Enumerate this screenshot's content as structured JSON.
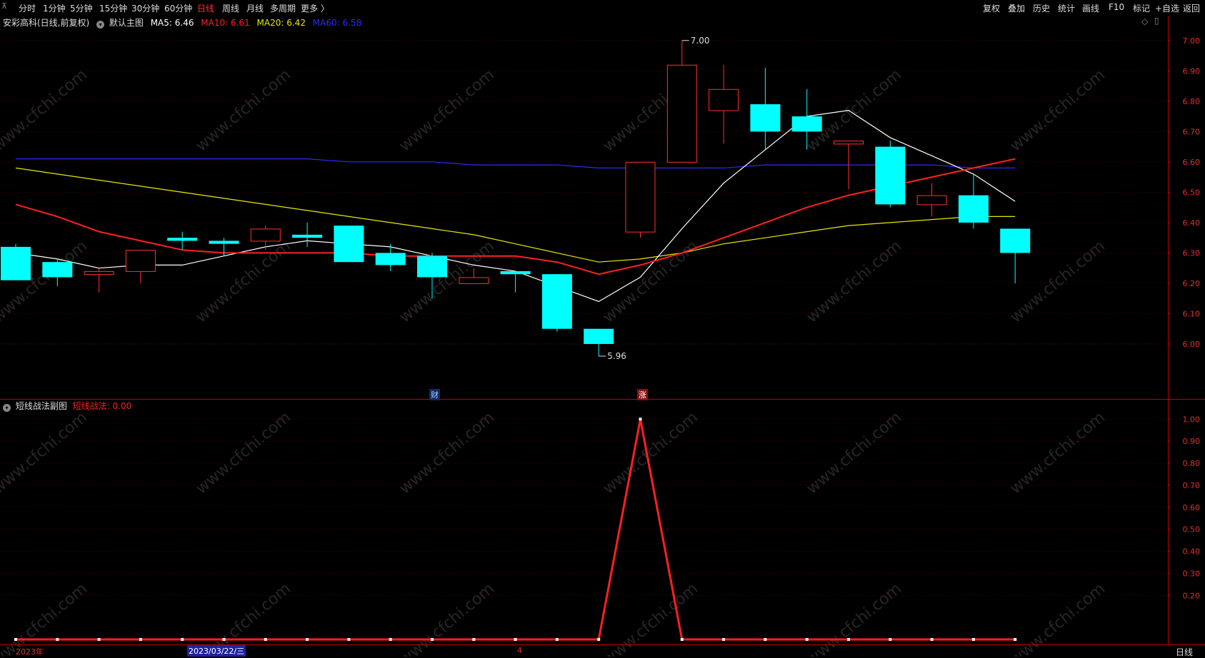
{
  "toolbar": {
    "left_items": [
      "分时",
      "1分钟",
      "5分钟",
      "15分钟",
      "30分钟",
      "60分钟",
      "日线",
      "周线",
      "月线",
      "多周期",
      "更多 〉"
    ],
    "active": "日线",
    "right_items": [
      "复权",
      "叠加",
      "历史",
      "统计",
      "画线",
      "F10",
      "标记",
      "+自选",
      "返回"
    ]
  },
  "main_info": {
    "stock": "安彩高科(日线,前复权)",
    "template": "默认主图",
    "ma": [
      {
        "label": "MA5: 6.46",
        "color": "#ffffff"
      },
      {
        "label": "MA10: 6.61",
        "color": "#ff2020"
      },
      {
        "label": "MA20: 6.42",
        "color": "#e8e800"
      },
      {
        "label": "MA60: 6.58",
        "color": "#2a2aff"
      }
    ]
  },
  "sub_info": {
    "title": "短线战法副图",
    "value_label": "短线战法: 0.00",
    "value_color": "#ff2020"
  },
  "footer": {
    "year": "2023年",
    "date": "2023/03/22/三",
    "month": "4",
    "period": "日线"
  },
  "markers": {
    "cai": "财",
    "zhang": "涨"
  },
  "watermark": "www.cfchi.com",
  "colors": {
    "up": "#ff3030",
    "down": "#00ffff",
    "grid": "#5a0000",
    "axis": "#c00000"
  },
  "chart_data": [
    {
      "type": "candlestick",
      "title": "安彩高科(日线,前复权)",
      "ylim": [
        5.92,
        7.03
      ],
      "y_ticks": [
        7.0,
        6.9,
        6.8,
        6.7,
        6.6,
        6.5,
        6.4,
        6.3,
        6.2,
        6.1,
        6.0
      ],
      "tick_labels": [
        "7.00",
        "6.90",
        "6.80",
        "6.70",
        "6.60",
        "6.50",
        "6.40",
        "6.30",
        "6.20",
        "6.10",
        "6.00"
      ],
      "candles": [
        {
          "o": 6.32,
          "c": 6.21,
          "h": 6.33,
          "l": 6.21
        },
        {
          "o": 6.27,
          "c": 6.22,
          "h": 6.28,
          "l": 6.19
        },
        {
          "o": 6.23,
          "c": 6.24,
          "h": 6.25,
          "l": 6.17
        },
        {
          "o": 6.24,
          "c": 6.31,
          "h": 6.31,
          "l": 6.2
        },
        {
          "o": 6.35,
          "c": 6.34,
          "h": 6.37,
          "l": 6.31
        },
        {
          "o": 6.34,
          "c": 6.33,
          "h": 6.35,
          "l": 6.29
        },
        {
          "o": 6.34,
          "c": 6.38,
          "h": 6.39,
          "l": 6.31
        },
        {
          "o": 6.36,
          "c": 6.35,
          "h": 6.4,
          "l": 6.32
        },
        {
          "o": 6.39,
          "c": 6.27,
          "h": 6.39,
          "l": 6.27
        },
        {
          "o": 6.3,
          "c": 6.26,
          "h": 6.33,
          "l": 6.24
        },
        {
          "o": 6.29,
          "c": 6.22,
          "h": 6.3,
          "l": 6.15
        },
        {
          "o": 6.2,
          "c": 6.22,
          "h": 6.25,
          "l": 6.2
        },
        {
          "o": 6.24,
          "c": 6.23,
          "h": 6.24,
          "l": 6.17
        },
        {
          "o": 6.23,
          "c": 6.05,
          "h": 6.23,
          "l": 6.04
        },
        {
          "o": 6.05,
          "c": 6.0,
          "h": 6.05,
          "l": 5.96
        },
        {
          "o": 6.37,
          "c": 6.6,
          "h": 6.6,
          "l": 6.35
        },
        {
          "o": 6.6,
          "c": 6.92,
          "h": 7.0,
          "l": 6.6
        },
        {
          "o": 6.77,
          "c": 6.84,
          "h": 6.92,
          "l": 6.66
        },
        {
          "o": 6.79,
          "c": 6.7,
          "h": 6.91,
          "l": 6.64
        },
        {
          "o": 6.75,
          "c": 6.7,
          "h": 6.84,
          "l": 6.64
        },
        {
          "o": 6.66,
          "c": 6.67,
          "h": 6.67,
          "l": 6.51
        },
        {
          "o": 6.65,
          "c": 6.46,
          "h": 6.67,
          "l": 6.45
        },
        {
          "o": 6.46,
          "c": 6.49,
          "h": 6.53,
          "l": 6.42
        },
        {
          "o": 6.49,
          "c": 6.4,
          "h": 6.56,
          "l": 6.38
        },
        {
          "o": 6.38,
          "c": 6.3,
          "h": 6.38,
          "l": 6.2
        }
      ],
      "series": [
        {
          "name": "MA5",
          "color": "#ffffff",
          "values": [
            6.3,
            6.28,
            6.25,
            6.26,
            6.26,
            6.29,
            6.32,
            6.34,
            6.33,
            6.32,
            6.29,
            6.26,
            6.24,
            6.19,
            6.14,
            6.22,
            6.38,
            6.53,
            6.64,
            6.75,
            6.77,
            6.68,
            6.62,
            6.56,
            6.47
          ]
        },
        {
          "name": "MA10",
          "color": "#ff2020",
          "values": [
            6.46,
            6.42,
            6.37,
            6.34,
            6.31,
            6.3,
            6.3,
            6.3,
            6.3,
            6.29,
            6.29,
            6.29,
            6.29,
            6.27,
            6.23,
            6.26,
            6.3,
            6.35,
            6.4,
            6.45,
            6.49,
            6.52,
            6.55,
            6.58,
            6.61
          ]
        },
        {
          "name": "MA20",
          "color": "#e8e800",
          "values": [
            6.58,
            6.56,
            6.54,
            6.52,
            6.5,
            6.48,
            6.46,
            6.44,
            6.42,
            6.4,
            6.38,
            6.36,
            6.33,
            6.3,
            6.27,
            6.28,
            6.3,
            6.33,
            6.35,
            6.37,
            6.39,
            6.4,
            6.41,
            6.42,
            6.42
          ]
        },
        {
          "name": "MA60",
          "color": "#2a2aff",
          "values": [
            6.61,
            6.61,
            6.61,
            6.61,
            6.61,
            6.61,
            6.61,
            6.61,
            6.6,
            6.6,
            6.6,
            6.59,
            6.59,
            6.59,
            6.58,
            6.58,
            6.58,
            6.58,
            6.59,
            6.59,
            6.59,
            6.59,
            6.59,
            6.58,
            6.58
          ]
        }
      ],
      "annotations": [
        {
          "index": 16,
          "price": 7.0,
          "text": "7.00"
        },
        {
          "index": 14,
          "price": 5.96,
          "text": "5.96"
        }
      ]
    },
    {
      "type": "line",
      "title": "短线战法副图",
      "ylim": [
        0,
        1.03
      ],
      "y_ticks": [
        1.0,
        0.9,
        0.8,
        0.7,
        0.6,
        0.5,
        0.4,
        0.3,
        0.2
      ],
      "tick_labels": [
        "1.00",
        "0.90",
        "0.80",
        "0.70",
        "0.60",
        "0.50",
        "0.40",
        "0.30",
        "0.20"
      ],
      "series": [
        {
          "name": "短线战法",
          "color": "#ff2020",
          "values": [
            0,
            0,
            0,
            0,
            0,
            0,
            0,
            0,
            0,
            0,
            0,
            0,
            0,
            0,
            0,
            1,
            0,
            0,
            0,
            0,
            0,
            0,
            0,
            0,
            0
          ]
        }
      ]
    }
  ]
}
